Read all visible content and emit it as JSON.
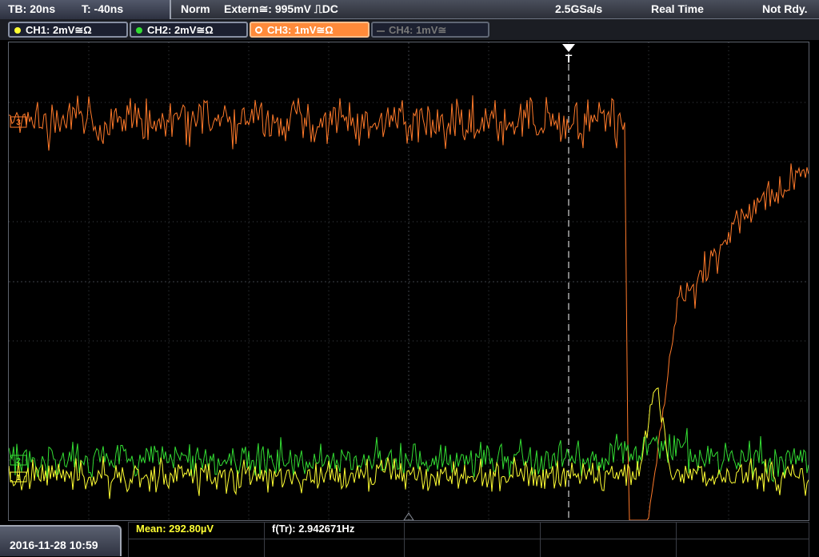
{
  "topbar": {
    "timebase": "TB: 20ns",
    "trigger_time": "T: -40ns",
    "mode": "Norm",
    "trigger_source": "Extern≅: 995mV ⎍DC",
    "sample_rate": "2.5GSa/s",
    "acq_mode": "Real Time",
    "status": "Not Rdy."
  },
  "channels": [
    {
      "label": "CH1: 2mV≅Ω",
      "color": "#ffff33",
      "active": true
    },
    {
      "label": "CH2: 2mV≅Ω",
      "color": "#33dd33",
      "active": true
    },
    {
      "label": "CH3: 1mV≅Ω",
      "color": "#ff8a3a",
      "active": true,
      "selected": true
    },
    {
      "label": "CH4: 1mV≅",
      "color": "#777777",
      "active": false
    }
  ],
  "trigger_marker": "T",
  "markers": {
    "ch1": "1",
    "ch2": "2",
    "ch3": "3"
  },
  "bottom": {
    "datetime": "2016-11-28 10:59",
    "mean": "Mean: 292.80µV",
    "freq": "f(Tr): 2.942671Hz"
  },
  "colors": {
    "ch1": "#ffff33",
    "ch2": "#33dd33",
    "ch3": "#ff7a2a",
    "grid": "#3f434a",
    "trigger_line": "#ffffff"
  }
}
